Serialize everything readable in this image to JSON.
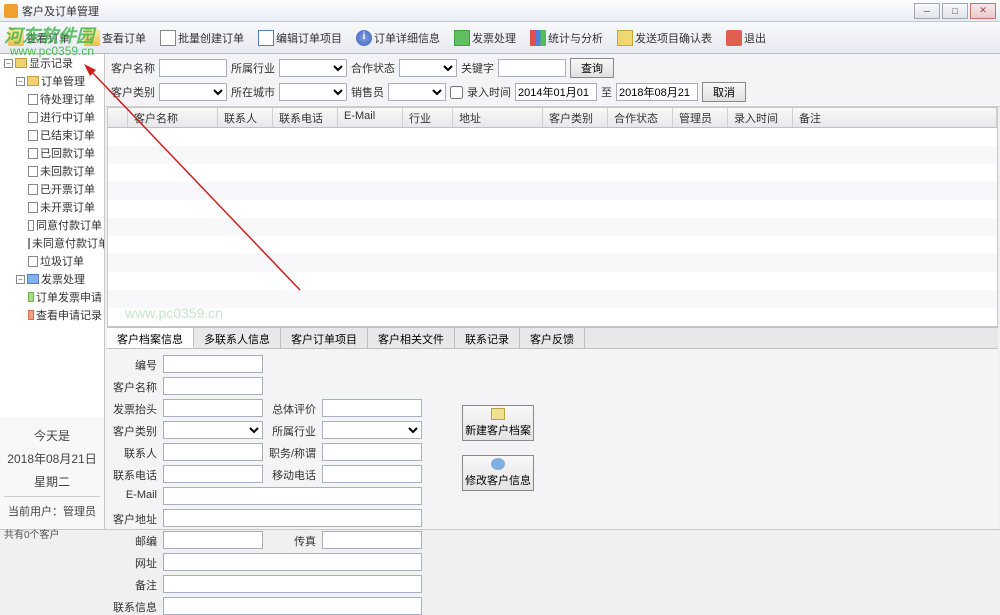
{
  "window": {
    "title": "客户及订单管理"
  },
  "toolbar": {
    "items": [
      "查看订单",
      "查看订单",
      "批量创建订单",
      "编辑订单项目",
      "订单详细信息",
      "发票处理",
      "统计与分析",
      "发送项目确认表",
      "退出"
    ]
  },
  "sidebar": {
    "root": "显示记录",
    "orders_group": "订单管理",
    "order_nodes": [
      "待处理订单",
      "进行中订单",
      "已结束订单",
      "已回款订单",
      "未回款订单",
      "已开票订单",
      "未开票订单",
      "同意付款订单",
      "未同意付款订单",
      "垃圾订单"
    ],
    "invoice_group": "发票处理",
    "invoice_nodes": [
      "订单发票申请",
      "查看申请记录"
    ]
  },
  "filters": {
    "customer_name_label": "客户名称",
    "industry_label": "所属行业",
    "partner_label": "合作状态",
    "keyword_label": "关键字",
    "category_label": "客户类别",
    "city_label": "所在城市",
    "sales_label": "销售员",
    "date_label": "录入时间",
    "date_from": "2014年01月01",
    "date_to_label": "至",
    "date_to": "2018年08月21",
    "search_btn": "查询",
    "cancel_btn": "取消"
  },
  "grid": {
    "columns": [
      "客户名称",
      "联系人",
      "联系电话",
      "E-Mail",
      "行业",
      "地址",
      "客户类别",
      "合作状态",
      "管理员",
      "录入时间",
      "备注"
    ]
  },
  "tabs": [
    "客户档案信息",
    "多联系人信息",
    "客户订单项目",
    "客户相关文件",
    "联系记录",
    "客户反馈"
  ],
  "form": {
    "no_label": "编号",
    "name_label": "客户名称",
    "invoice_title_label": "发票抬头",
    "overall_label": "总体评价",
    "category_label": "客户类别",
    "industry_label": "所属行业",
    "contact_label": "联系人",
    "position_label": "职务/称谓",
    "phone_label": "联系电话",
    "mobile_label": "移动电话",
    "email_label": "E-Mail",
    "address_label": "客户地址",
    "zip_label": "邮编",
    "fax_label": "传真",
    "website_label": "网址",
    "note_label": "备注",
    "contact_info_label": "联系信息"
  },
  "actions": {
    "new_btn": "新建客户档案",
    "edit_btn": "修改客户信息"
  },
  "date_panel": {
    "today_label": "今天是",
    "date": "2018年08月21日",
    "weekday": "星期二",
    "user_label": "当前用户：",
    "user": "管理员"
  },
  "statusbar": "共有0个客户",
  "watermark": {
    "name": "河东软件园",
    "url": "www.pc0359.cn"
  }
}
